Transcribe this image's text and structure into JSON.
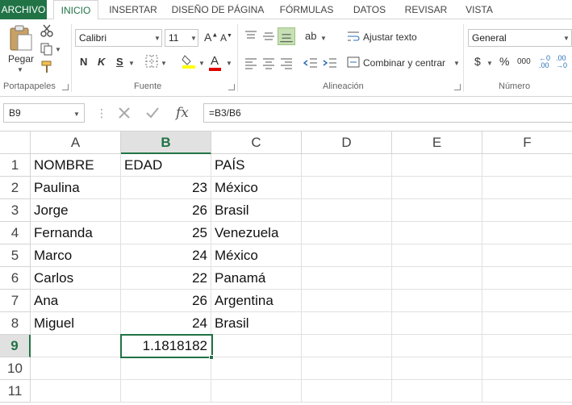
{
  "ribbon_tabs": [
    "ARCHIVO",
    "INICIO",
    "INSERTAR",
    "DISEÑO DE PÁGINA",
    "FÓRMULAS",
    "DATOS",
    "REVISAR",
    "VISTA"
  ],
  "clipboard": {
    "paste_label": "Pegar",
    "group_label": "Portapapeles"
  },
  "font": {
    "name": "Calibri",
    "size": "11",
    "bold": "N",
    "italic": "K",
    "underline": "S",
    "group_label": "Fuente"
  },
  "alignment": {
    "wrap_label": "Ajustar texto",
    "merge_label": "Combinar y centrar",
    "group_label": "Alineación"
  },
  "number": {
    "format": "General",
    "currency": "$",
    "percent": "%",
    "thousands": "000",
    "group_label": "Número"
  },
  "formula_bar": {
    "name_box": "B9",
    "formula": "=B3/B6",
    "fx": "fx"
  },
  "columns": [
    "A",
    "B",
    "C",
    "D",
    "E",
    "F"
  ],
  "rows": [
    "1",
    "2",
    "3",
    "4",
    "5",
    "6",
    "7",
    "8",
    "9",
    "10",
    "11"
  ],
  "sheet": {
    "header": [
      "NOMBRE",
      "EDAD",
      "PAÍS"
    ],
    "data": [
      [
        "Paulina",
        "23",
        "México"
      ],
      [
        "Jorge",
        "26",
        "Brasil"
      ],
      [
        "Fernanda",
        "25",
        "Venezuela"
      ],
      [
        "Marco",
        "24",
        "México"
      ],
      [
        "Carlos",
        "22",
        "Panamá"
      ],
      [
        "Ana",
        "26",
        "Argentina"
      ],
      [
        "Miguel",
        "24",
        "Brasil"
      ]
    ],
    "b9": "1.1818182"
  },
  "colors": {
    "accent": "#217346",
    "selected_align": "#c6e0b4"
  }
}
